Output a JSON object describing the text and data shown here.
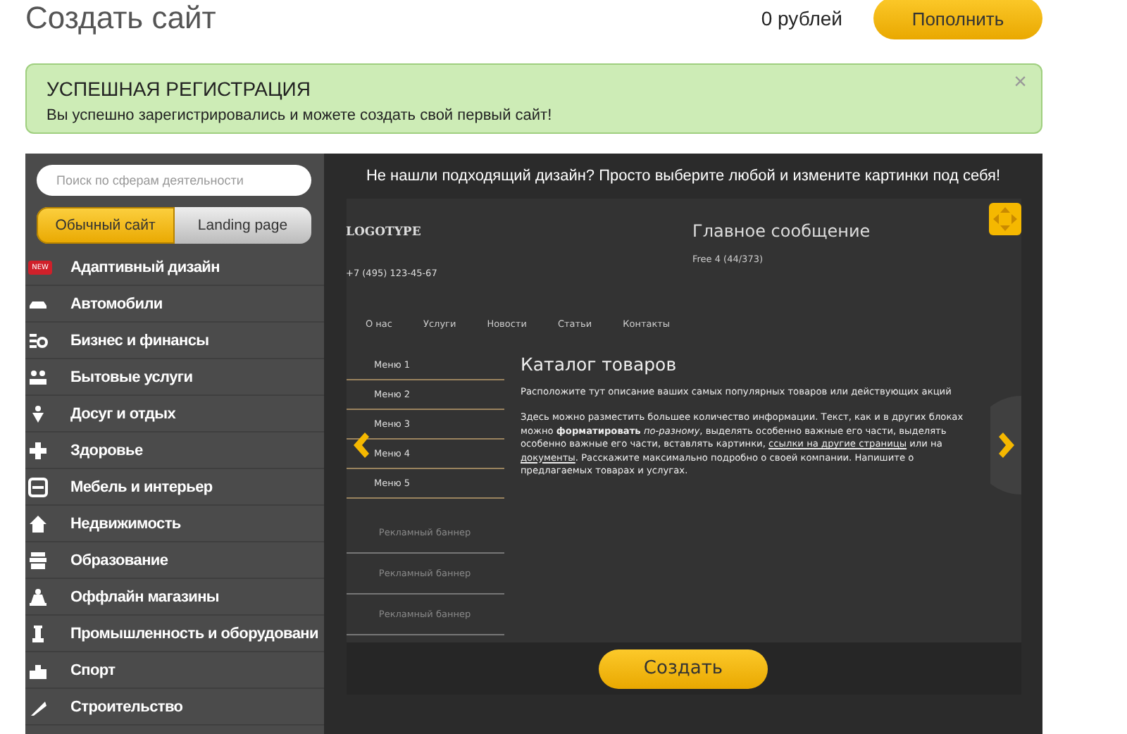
{
  "header": {
    "title": "Создать сайт",
    "balance": "0 рублей",
    "topup_button": "Пополнить"
  },
  "alert": {
    "title": "УСПЕШНАЯ РЕГИСТРАЦИЯ",
    "message": "Вы успешно зарегистрировались и можете создать свой первый сайт!",
    "close": "×"
  },
  "sidebar": {
    "search": {
      "placeholder": "Поиск по сферам деятельности"
    },
    "toggle": [
      {
        "label": "Обычный сайт",
        "selected": true
      },
      {
        "label": "Landing page",
        "selected": false
      }
    ],
    "categories": [
      {
        "label": "Адаптивный дизайн",
        "badge": "NEW"
      },
      {
        "label": "Автомобили"
      },
      {
        "label": "Бизнес и финансы"
      },
      {
        "label": "Бытовые услуги"
      },
      {
        "label": "Досуг и отдых"
      },
      {
        "label": "Здоровье"
      },
      {
        "label": "Мебель и интерьер"
      },
      {
        "label": "Недвижимость"
      },
      {
        "label": "Образование"
      },
      {
        "label": "Оффлайн магазины"
      },
      {
        "label": "Промышленность и оборудовани"
      },
      {
        "label": "Спорт"
      },
      {
        "label": "Строительство"
      }
    ]
  },
  "main": {
    "heading": "Не нашли подходящий дизайн? Просто выберите любой и измените картинки под себя!",
    "preview": {
      "logo": "LOGOTYPE",
      "phone": "+7 (495) 123-45-67",
      "headline": "Главное сообщение",
      "template_name": "Free 4 (44/373)",
      "nav": [
        "О нас",
        "Услуги",
        "Новости",
        "Статьи",
        "Контакты"
      ],
      "menu": [
        "Меню 1",
        "Меню 2",
        "Меню 3",
        "Меню 4",
        "Меню 5"
      ],
      "banners": [
        "Рекламный баннер",
        "Рекламный баннер",
        "Рекламный баннер"
      ],
      "content_title": "Каталог товаров",
      "intro": "Расположите тут описание ваших самых популярных товаров или действующих акций",
      "body": [
        {
          "kind": "text",
          "text": "Здесь можно разместить большее количество информации. Текст, как и в других блоках можно **форматировать** *по-разному*, выделять особенно важные его части, выделять особенно важные его части, вставлять картинки, "
        },
        {
          "kind": "link",
          "text": "ссылки на другие страницы"
        },
        {
          "kind": "text",
          "text": " или на "
        },
        {
          "kind": "link",
          "text": "документы"
        },
        {
          "kind": "text",
          "text": ". Расскажите максимально подробно о своей компании. Напишите о предлагаемых товарах и услугах."
        }
      ]
    },
    "create_button": "Создать"
  }
}
